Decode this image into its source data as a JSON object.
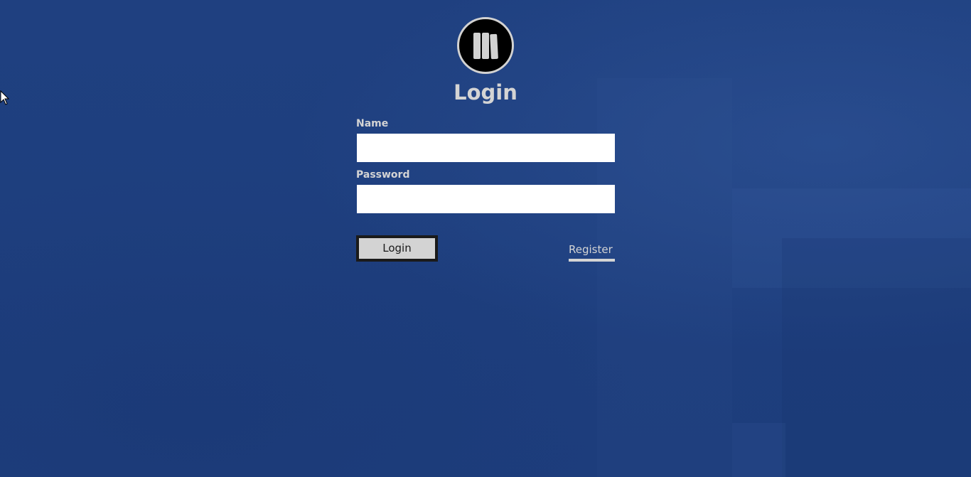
{
  "page": {
    "title": "Login"
  },
  "logo": {
    "icon": "books-icon"
  },
  "form": {
    "name_label": "Name",
    "name_value": "",
    "password_label": "Password",
    "password_value": "",
    "login_button": "Login",
    "register_link": "Register"
  },
  "colors": {
    "background": "#1e3f7f",
    "text": "#d4d4d4",
    "button_bg": "#d3d3d3",
    "button_border": "#1a1a1a",
    "input_bg": "#ffffff"
  }
}
